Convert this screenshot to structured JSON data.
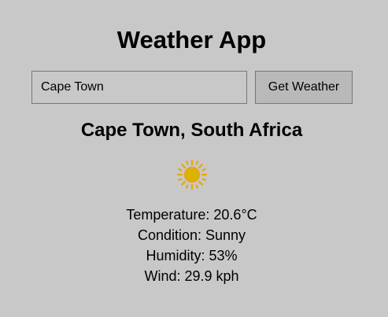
{
  "app": {
    "title": "Weather App"
  },
  "search": {
    "value": "Cape Town",
    "button_label": "Get Weather"
  },
  "result": {
    "location": "Cape Town, South Africa",
    "icon": "sun-icon",
    "icon_color": "#e6b800",
    "temperature": "Temperature: 20.6°C",
    "condition": "Condition: Sunny",
    "humidity": "Humidity: 53%",
    "wind": "Wind: 29.9 kph"
  }
}
